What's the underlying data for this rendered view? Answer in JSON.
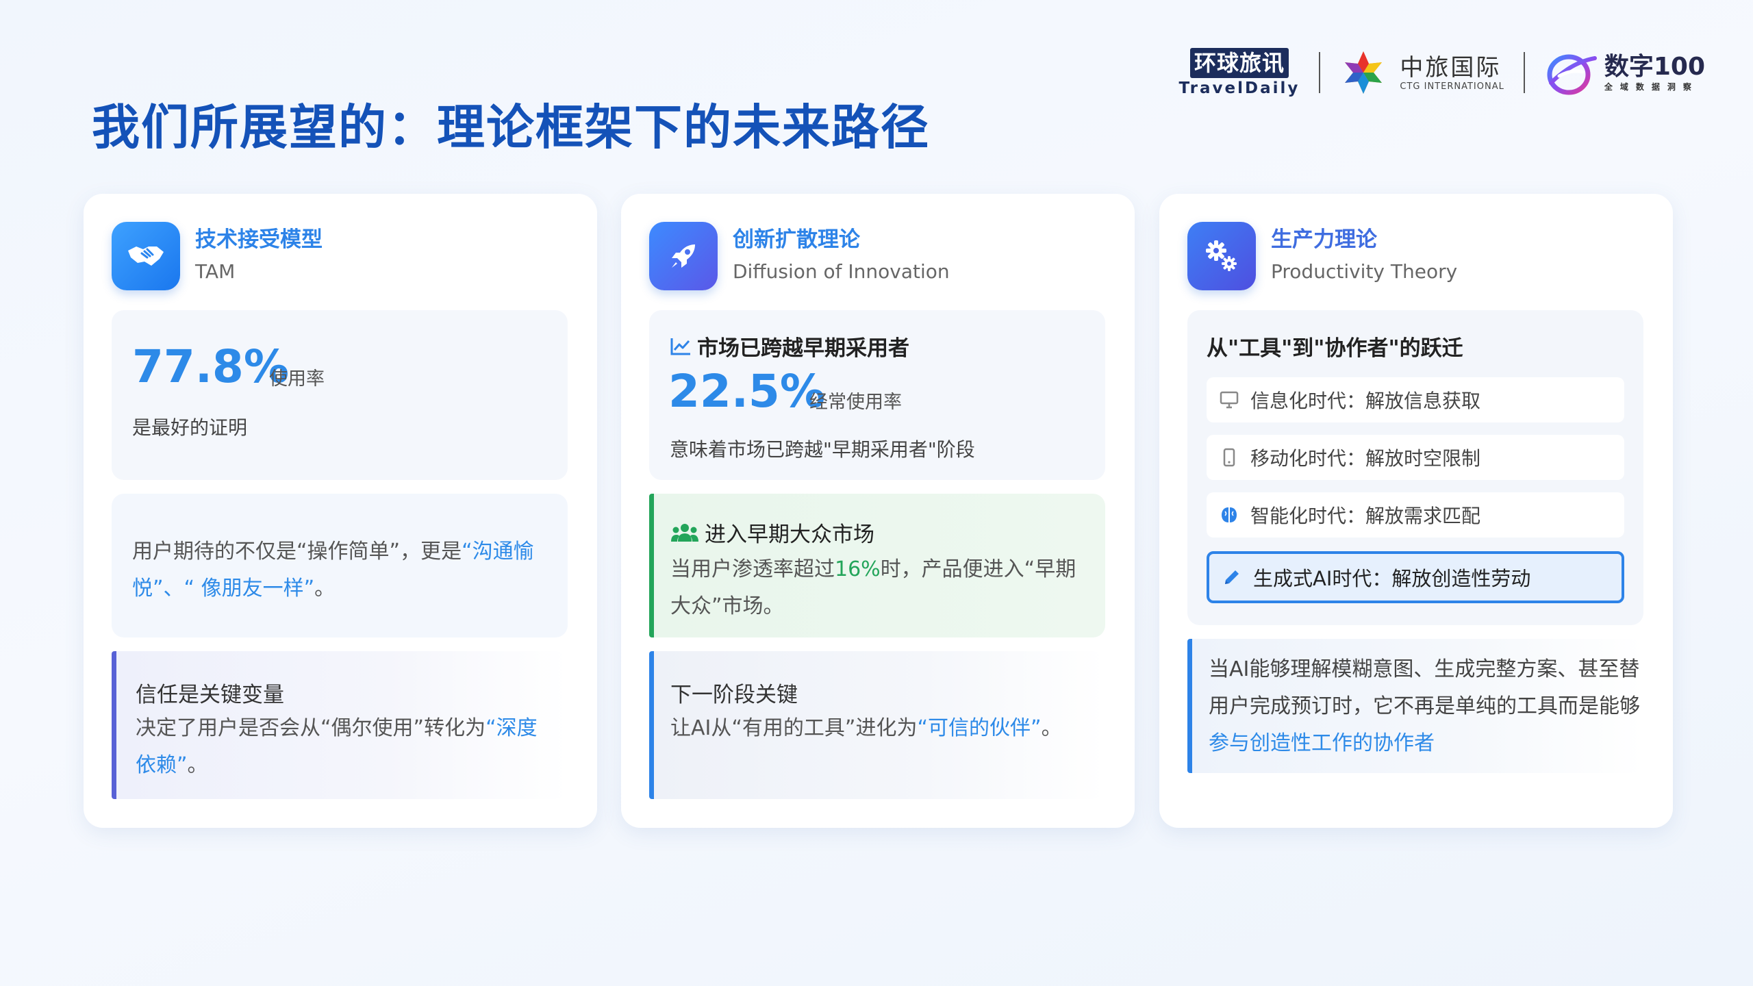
{
  "title": "我们所展望的：理论框架下的未来路径",
  "logos": {
    "traveldaily_cn": "环球旅讯",
    "traveldaily_en": "TravelDaily",
    "ctg_cn": "中旅国际",
    "ctg_en": "CTG INTERNATIONAL",
    "d100_cn": "数字100",
    "d100_en": "全域数据洞察"
  },
  "cards": {
    "tam": {
      "icon": "handshake-icon",
      "title": "技术接受模型",
      "subtitle": "TAM",
      "stat_value": "77.8%",
      "stat_unit": "使用率",
      "stat_desc": "是最好的证明",
      "expectation_pre": "用户期待的不仅是“操作简单”，更是",
      "expectation_hl": "“沟通愉悦”、“ 像朋友一样”",
      "expectation_post": "。",
      "trust_title": "信任是关键变量",
      "trust_pre": "决定了用户是否会从“偶尔使用”转化为",
      "trust_hl": "“深度依赖”",
      "trust_post": "。"
    },
    "diffusion": {
      "icon": "rocket-icon",
      "title": "创新扩散理论",
      "subtitle": "Diffusion of Innovation",
      "market_title": "市场已跨越早期采用者",
      "stat_value": "22.5%",
      "stat_unit": "经常使用率",
      "stat_desc": "意味着市场已跨越\"早期采用者\"阶段",
      "majority_title": "进入早期大众市场",
      "majority_pre": "当用户渗透率超过",
      "majority_hl": "16%",
      "majority_post": "时，产品便进入“早期大众”市场。",
      "next_title": "下一阶段关键",
      "next_pre": "让AI从“有用的工具”进化为",
      "next_hl": "“可信的伙伴”",
      "next_post": "。"
    },
    "productivity": {
      "icon": "gears-icon",
      "title": "生产力理论",
      "subtitle": "Productivity Theory",
      "shift_title": "从\"工具\"到\"协作者\"的跃迁",
      "eras": [
        {
          "icon": "monitor-icon",
          "label": "信息化时代：解放信息获取"
        },
        {
          "icon": "mobile-icon",
          "label": "移动化时代：解放时空限制"
        },
        {
          "icon": "brain-icon",
          "label": "智能化时代：解放需求匹配"
        },
        {
          "icon": "pencil-icon",
          "label": "生成式AI时代：解放创造性劳动"
        }
      ],
      "conclusion_pre": "当AI能够理解模糊意图、生成完整方案、甚至替用户完成预订时，它不再是单纯的工具而是能够",
      "conclusion_hl": "参与创造性工作的协作者"
    }
  }
}
